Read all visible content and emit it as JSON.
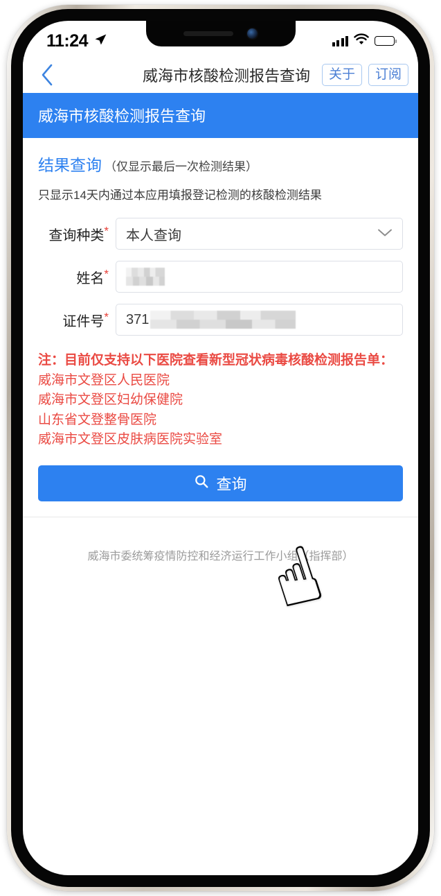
{
  "status_bar": {
    "time": "11:24",
    "location_icon": "location-arrow-icon",
    "signal_icon": "cellular-signal-icon",
    "wifi_icon": "wifi-icon",
    "battery_icon": "battery-icon"
  },
  "navbar": {
    "back_icon": "back-chevron-icon",
    "title": "威海市核酸检测报告查询",
    "about_label": "关于",
    "subscribe_label": "订阅"
  },
  "app": {
    "header_title": "威海市核酸检测报告查询",
    "section_title": "结果查询",
    "section_subtitle": "（仅显示最后一次检测结果）",
    "section_description": "只显示14天内通过本应用填报登记检测的核酸检测结果"
  },
  "form": {
    "required_mark": "*",
    "rows": [
      {
        "label": "查询种类",
        "value": "本人查询",
        "type": "select",
        "icon": "chevron-down-icon"
      },
      {
        "label": "姓名",
        "value": "",
        "type": "redacted-text",
        "redaction": "mosaic"
      },
      {
        "label": "证件号",
        "value": "371",
        "type": "redacted-text",
        "redaction": "mosaic"
      }
    ]
  },
  "notice": {
    "heading": "注：目前仅支持以下医院查看新型冠状病毒核酸检测报告单：",
    "hospitals": [
      "威海市文登区人民医院",
      "威海市文登区妇幼保健院",
      "山东省文登整骨医院",
      "威海市文登区皮肤病医院实验室"
    ],
    "color": "#ea4a43"
  },
  "submit": {
    "label": "查询",
    "icon": "search-icon",
    "color": "#2d81f0"
  },
  "footer": {
    "text": "威海市委统筹疫情防控和经济运行工作小组（指挥部）"
  },
  "overlay": {
    "cursor_icon": "pointing-hand-icon",
    "glyph": "☝"
  },
  "theme": {
    "accent_blue": "#2d81f0",
    "notice_red": "#ea4a43",
    "nav_button_border": "#a8c8f0",
    "field_border": "#dcdfe6"
  }
}
